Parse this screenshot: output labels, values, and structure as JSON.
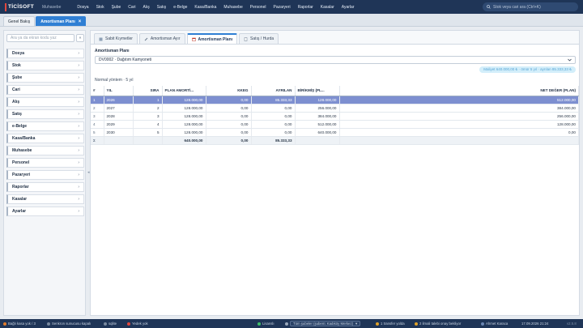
{
  "topbar": {
    "brand": "TİCİSOFT",
    "module": "Muhasebe",
    "menu": [
      "Dosya",
      "Stok",
      "Şube",
      "Cari",
      "Alış",
      "Satış",
      "e-Belge",
      "Kasa/Banka",
      "Muhasebe",
      "Personel",
      "Pazaryeri",
      "Raporlar",
      "Kasalar",
      "Ayarlar"
    ],
    "search_placeholder": "Stok veya cari ara (Ctrl+K)"
  },
  "window_tabs": [
    {
      "label": "Genel Bakış",
      "active": false
    },
    {
      "label": "Amortisman Planı",
      "active": true,
      "close": "×"
    }
  ],
  "sidebar": {
    "search_placeholder": "Ara ya da ekran kodu yaz",
    "collapse": "«",
    "items": [
      "Dosya",
      "Stok",
      "Şube",
      "Cari",
      "Alış",
      "Satış",
      "e-Belge",
      "Kasa/Banka",
      "Muhasebe",
      "Personel",
      "Pazaryeri",
      "Raporlar",
      "Kasalar",
      "Ayarlar"
    ],
    "chevron": "›"
  },
  "subtabs": [
    {
      "label": "Sabit Kıymetler",
      "active": false,
      "icon": "cube-icon"
    },
    {
      "label": "Amortisman Ayır",
      "active": false,
      "icon": "wrench-icon"
    },
    {
      "label": "Amortisman Planı",
      "active": true,
      "icon": "calendar-icon"
    },
    {
      "label": "Satış / Hurda",
      "active": false,
      "icon": "document-icon"
    }
  ],
  "plan": {
    "section_title": "Amortisman Planı",
    "asset_select": "DV0002 · Dağıtım Kamyoneti",
    "summary": "Maliyet 640.000,00 ₺ · ömür 5 yıl · ayrılan 85.333,33 ₺",
    "period": "Normal yöntem · 5 yıl"
  },
  "table": {
    "columns": [
      "#",
      "YIL",
      "SIRA",
      "PLAN AMORTİ...",
      "KKEG",
      "AYRILAN",
      "BİRİKMİŞ (PL...",
      "NET DEĞER (PLAN)"
    ],
    "rows": [
      [
        "1",
        "2026",
        "1",
        "128.000,00",
        "0,00",
        "85.333,33",
        "128.000,00",
        "512.000,00"
      ],
      [
        "2",
        "2027",
        "2",
        "128.000,00",
        "0,00",
        "0,00",
        "256.000,00",
        "384.000,00"
      ],
      [
        "3",
        "2028",
        "3",
        "128.000,00",
        "0,00",
        "0,00",
        "384.000,00",
        "256.000,00"
      ],
      [
        "4",
        "2029",
        "4",
        "128.000,00",
        "0,00",
        "0,00",
        "512.000,00",
        "128.000,00"
      ],
      [
        "5",
        "2030",
        "5",
        "128.000,00",
        "0,00",
        "0,00",
        "640.000,00",
        "0,00"
      ]
    ],
    "selected_row": 0,
    "total": [
      "Σ",
      "",
      "",
      "640.000,00",
      "0,00",
      "85.333,33",
      "",
      ""
    ]
  },
  "statusbar": {
    "items": [
      "Bağlı kasa yok / 3",
      "Senkron sunucusu kapalı",
      "sqlite",
      "Yedek yok",
      "Lisanslı",
      "Tüm şubeler (şubem: Kadıköy Merkez)",
      "1 transfer yolda",
      "2 ilmali talebi onay bekliyor",
      "Ahmet Karaca",
      "17.09.2026 21:24",
      "v2.5.8"
    ]
  },
  "colors": {
    "topbar": "#1f3557",
    "accent": "#2f7fd4",
    "selected_row": "#7d8fd0",
    "summary_bg": "#d3eefa"
  }
}
